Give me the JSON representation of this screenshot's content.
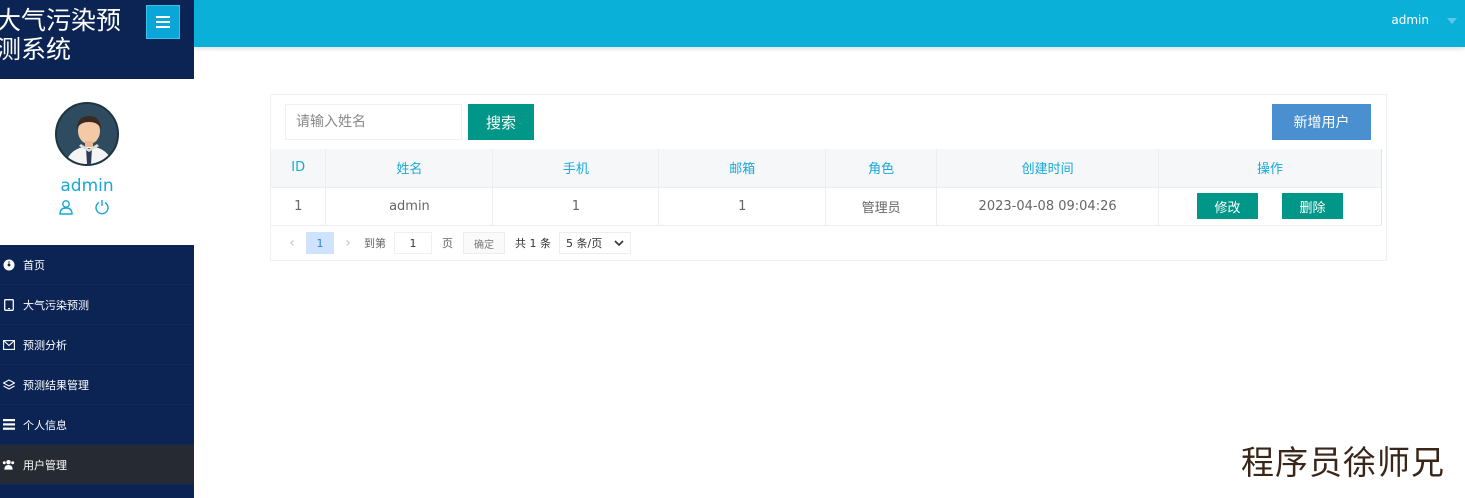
{
  "app": {
    "title": "大气污染预测系统"
  },
  "header": {
    "user": "admin"
  },
  "profile": {
    "name": "admin"
  },
  "nav": {
    "items": [
      {
        "label": "首页",
        "icon": "dashboard-icon"
      },
      {
        "label": "大气污染预测",
        "icon": "tablet-icon"
      },
      {
        "label": "预测分析",
        "icon": "envelope-icon"
      },
      {
        "label": "预测结果管理",
        "icon": "layers-icon"
      },
      {
        "label": "个人信息",
        "icon": "list-icon"
      },
      {
        "label": "用户管理",
        "icon": "users-icon",
        "active": true
      }
    ]
  },
  "toolbar": {
    "search_placeholder": "请输入姓名",
    "search_label": "搜索",
    "add_label": "新增用户"
  },
  "table": {
    "columns": [
      "ID",
      "姓名",
      "手机",
      "邮箱",
      "角色",
      "创建时间",
      "操作"
    ],
    "rows": [
      {
        "id": "1",
        "name": "admin",
        "phone": "1",
        "email": "1",
        "role": "管理员",
        "created": "2023-04-08 09:04:26",
        "edit": "修改",
        "delete": "删除"
      }
    ]
  },
  "pager": {
    "current": "1",
    "goto_prefix": "到第",
    "goto_value": "1",
    "goto_suffix": "页",
    "confirm": "确定",
    "total": "共 1 条",
    "page_size": "5 条/页"
  },
  "watermark": "程序员徐师兄",
  "colors": {
    "sidebar": "#0b2454",
    "header": "#0ab0d8",
    "primary": "#009688",
    "add": "#4a8fd0"
  }
}
